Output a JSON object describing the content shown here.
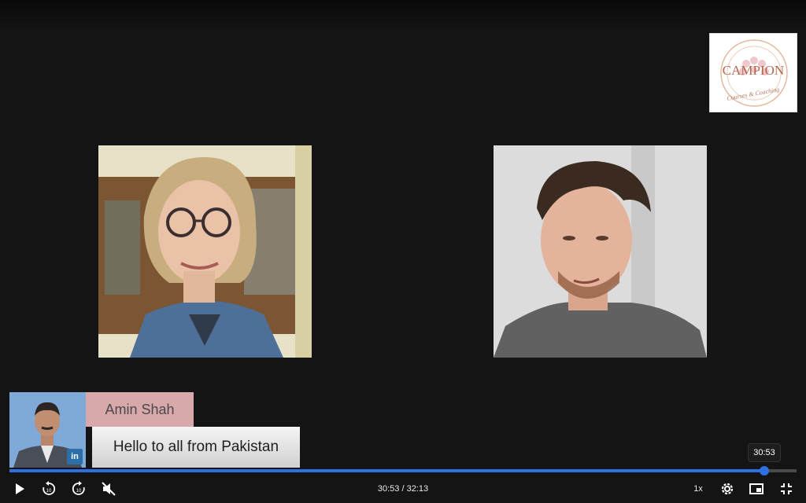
{
  "logo": {
    "text": "CAMPION",
    "subtitle": "Courses & Coaching"
  },
  "lower_third": {
    "name": "Amin Shah",
    "message": "Hello to all from Pakistan",
    "badge": "in"
  },
  "player": {
    "current_time": "30:53",
    "duration": "32:13",
    "time_display": "30:53 / 32:13",
    "tooltip_time": "30:53",
    "progress": 0.959,
    "speed": "1x"
  },
  "colors": {
    "accent": "#2f6fe0",
    "background": "#141414",
    "name_bg": "#d9a8aa"
  },
  "icons": [
    "play-icon",
    "rewind-10-icon",
    "forward-10-icon",
    "mute-icon",
    "settings-icon",
    "picture-in-picture-icon",
    "exit-fullscreen-icon",
    "linkedin-icon"
  ]
}
